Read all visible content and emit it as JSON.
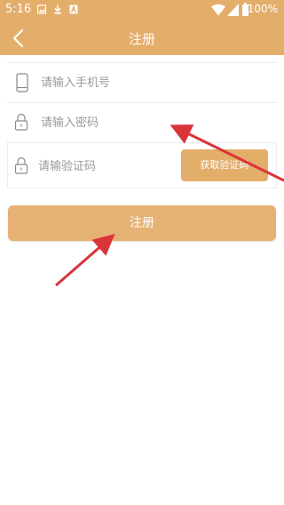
{
  "status_bar": {
    "time": "5:16",
    "battery": "100%",
    "left_icons": [
      "image-icon",
      "download-icon",
      "a-icon"
    ],
    "right_icons": [
      "wifi-icon",
      "signal-icon",
      "battery-icon"
    ]
  },
  "header": {
    "title": "注册",
    "back_icon": "chevron-left-icon"
  },
  "form": {
    "phone_placeholder": "请输入手机号",
    "password_placeholder": "请输入密码",
    "code_placeholder": "请输验证码",
    "get_code_label": "获取验证码",
    "submit_label": "注册"
  },
  "colors": {
    "brand": "#e3ad6a",
    "annotation_arrow": "#d9343a"
  }
}
